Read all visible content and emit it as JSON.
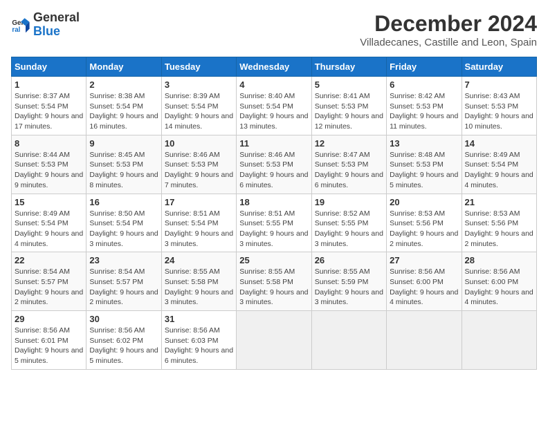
{
  "logo": {
    "line1": "General",
    "line2": "Blue"
  },
  "title": "December 2024",
  "subtitle": "Villadecanes, Castille and Leon, Spain",
  "headers": [
    "Sunday",
    "Monday",
    "Tuesday",
    "Wednesday",
    "Thursday",
    "Friday",
    "Saturday"
  ],
  "weeks": [
    [
      {
        "day": "1",
        "info": "Sunrise: 8:37 AM\nSunset: 5:54 PM\nDaylight: 9 hours and 17 minutes."
      },
      {
        "day": "2",
        "info": "Sunrise: 8:38 AM\nSunset: 5:54 PM\nDaylight: 9 hours and 16 minutes."
      },
      {
        "day": "3",
        "info": "Sunrise: 8:39 AM\nSunset: 5:54 PM\nDaylight: 9 hours and 14 minutes."
      },
      {
        "day": "4",
        "info": "Sunrise: 8:40 AM\nSunset: 5:54 PM\nDaylight: 9 hours and 13 minutes."
      },
      {
        "day": "5",
        "info": "Sunrise: 8:41 AM\nSunset: 5:53 PM\nDaylight: 9 hours and 12 minutes."
      },
      {
        "day": "6",
        "info": "Sunrise: 8:42 AM\nSunset: 5:53 PM\nDaylight: 9 hours and 11 minutes."
      },
      {
        "day": "7",
        "info": "Sunrise: 8:43 AM\nSunset: 5:53 PM\nDaylight: 9 hours and 10 minutes."
      }
    ],
    [
      {
        "day": "8",
        "info": "Sunrise: 8:44 AM\nSunset: 5:53 PM\nDaylight: 9 hours and 9 minutes."
      },
      {
        "day": "9",
        "info": "Sunrise: 8:45 AM\nSunset: 5:53 PM\nDaylight: 9 hours and 8 minutes."
      },
      {
        "day": "10",
        "info": "Sunrise: 8:46 AM\nSunset: 5:53 PM\nDaylight: 9 hours and 7 minutes."
      },
      {
        "day": "11",
        "info": "Sunrise: 8:46 AM\nSunset: 5:53 PM\nDaylight: 9 hours and 6 minutes."
      },
      {
        "day": "12",
        "info": "Sunrise: 8:47 AM\nSunset: 5:53 PM\nDaylight: 9 hours and 6 minutes."
      },
      {
        "day": "13",
        "info": "Sunrise: 8:48 AM\nSunset: 5:53 PM\nDaylight: 9 hours and 5 minutes."
      },
      {
        "day": "14",
        "info": "Sunrise: 8:49 AM\nSunset: 5:54 PM\nDaylight: 9 hours and 4 minutes."
      }
    ],
    [
      {
        "day": "15",
        "info": "Sunrise: 8:49 AM\nSunset: 5:54 PM\nDaylight: 9 hours and 4 minutes."
      },
      {
        "day": "16",
        "info": "Sunrise: 8:50 AM\nSunset: 5:54 PM\nDaylight: 9 hours and 3 minutes."
      },
      {
        "day": "17",
        "info": "Sunrise: 8:51 AM\nSunset: 5:54 PM\nDaylight: 9 hours and 3 minutes."
      },
      {
        "day": "18",
        "info": "Sunrise: 8:51 AM\nSunset: 5:55 PM\nDaylight: 9 hours and 3 minutes."
      },
      {
        "day": "19",
        "info": "Sunrise: 8:52 AM\nSunset: 5:55 PM\nDaylight: 9 hours and 3 minutes."
      },
      {
        "day": "20",
        "info": "Sunrise: 8:53 AM\nSunset: 5:56 PM\nDaylight: 9 hours and 2 minutes."
      },
      {
        "day": "21",
        "info": "Sunrise: 8:53 AM\nSunset: 5:56 PM\nDaylight: 9 hours and 2 minutes."
      }
    ],
    [
      {
        "day": "22",
        "info": "Sunrise: 8:54 AM\nSunset: 5:57 PM\nDaylight: 9 hours and 2 minutes."
      },
      {
        "day": "23",
        "info": "Sunrise: 8:54 AM\nSunset: 5:57 PM\nDaylight: 9 hours and 2 minutes."
      },
      {
        "day": "24",
        "info": "Sunrise: 8:55 AM\nSunset: 5:58 PM\nDaylight: 9 hours and 3 minutes."
      },
      {
        "day": "25",
        "info": "Sunrise: 8:55 AM\nSunset: 5:58 PM\nDaylight: 9 hours and 3 minutes."
      },
      {
        "day": "26",
        "info": "Sunrise: 8:55 AM\nSunset: 5:59 PM\nDaylight: 9 hours and 3 minutes."
      },
      {
        "day": "27",
        "info": "Sunrise: 8:56 AM\nSunset: 6:00 PM\nDaylight: 9 hours and 4 minutes."
      },
      {
        "day": "28",
        "info": "Sunrise: 8:56 AM\nSunset: 6:00 PM\nDaylight: 9 hours and 4 minutes."
      }
    ],
    [
      {
        "day": "29",
        "info": "Sunrise: 8:56 AM\nSunset: 6:01 PM\nDaylight: 9 hours and 5 minutes."
      },
      {
        "day": "30",
        "info": "Sunrise: 8:56 AM\nSunset: 6:02 PM\nDaylight: 9 hours and 5 minutes."
      },
      {
        "day": "31",
        "info": "Sunrise: 8:56 AM\nSunset: 6:03 PM\nDaylight: 9 hours and 6 minutes."
      },
      null,
      null,
      null,
      null
    ]
  ]
}
